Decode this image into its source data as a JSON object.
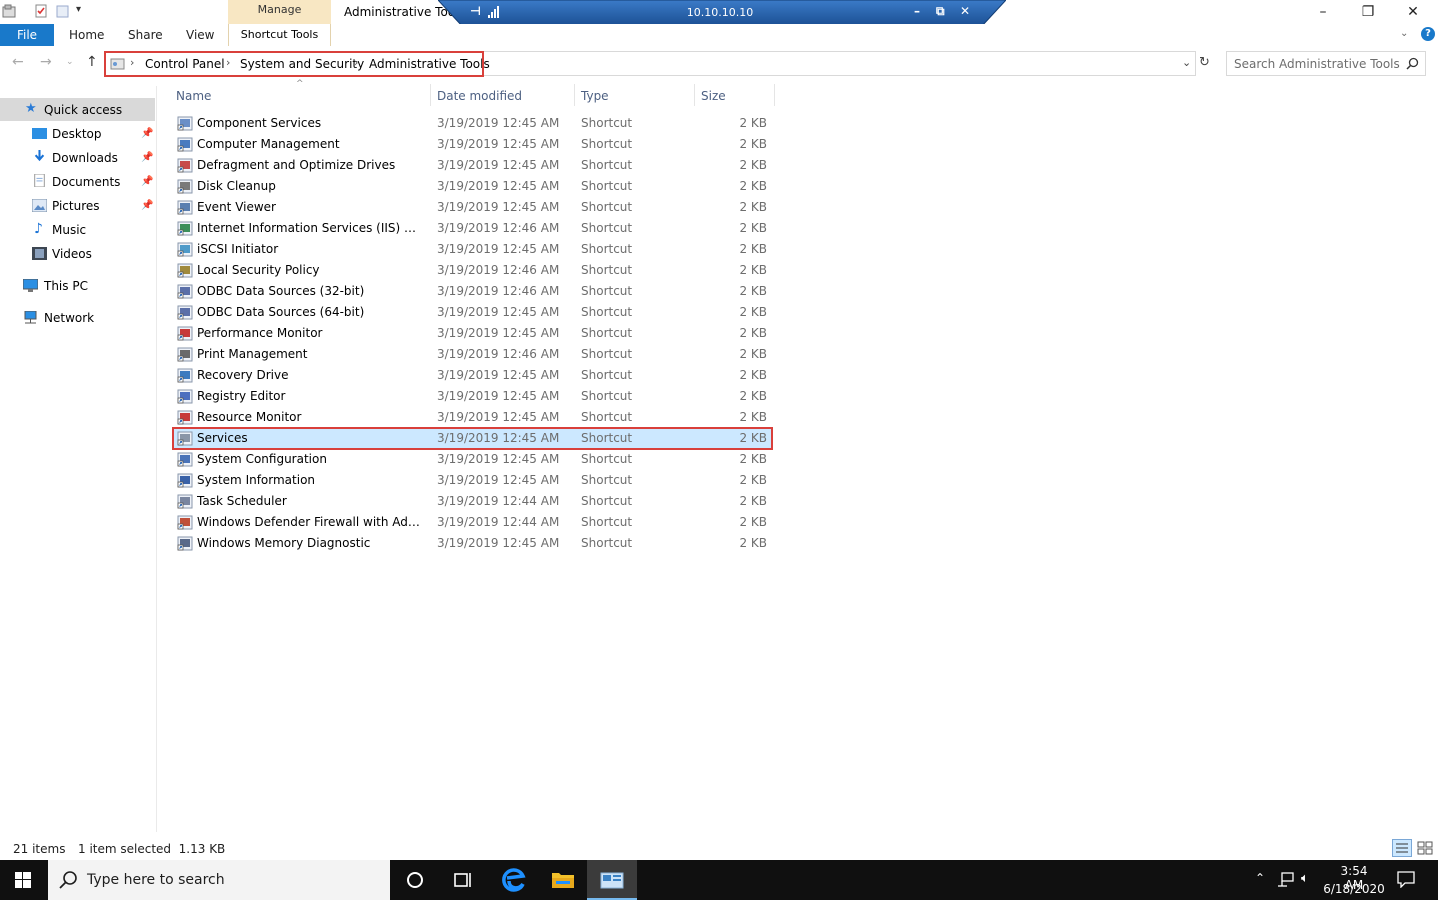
{
  "window": {
    "title": "Administrative Tools",
    "contextual_group": "Manage",
    "contextual_tab": "Shortcut Tools"
  },
  "rdp": {
    "host": "10.10.10.10"
  },
  "ribbon": {
    "tabs": [
      "File",
      "Home",
      "Share",
      "View"
    ]
  },
  "address": {
    "breadcrumbs": [
      "Control Panel",
      "System and Security",
      "Administrative Tools"
    ],
    "search_placeholder": "Search Administrative Tools"
  },
  "navpane": {
    "quick_access": "Quick access",
    "items": [
      "Desktop",
      "Downloads",
      "Documents",
      "Pictures",
      "Music",
      "Videos"
    ],
    "this_pc": "This PC",
    "network": "Network"
  },
  "columns": {
    "name": "Name",
    "date": "Date modified",
    "type": "Type",
    "size": "Size"
  },
  "files": [
    {
      "name": "Component Services",
      "date": "3/19/2019 12:45 AM",
      "type": "Shortcut",
      "size": "2 KB"
    },
    {
      "name": "Computer Management",
      "date": "3/19/2019 12:45 AM",
      "type": "Shortcut",
      "size": "2 KB"
    },
    {
      "name": "Defragment and Optimize Drives",
      "date": "3/19/2019 12:45 AM",
      "type": "Shortcut",
      "size": "2 KB"
    },
    {
      "name": "Disk Cleanup",
      "date": "3/19/2019 12:45 AM",
      "type": "Shortcut",
      "size": "2 KB"
    },
    {
      "name": "Event Viewer",
      "date": "3/19/2019 12:45 AM",
      "type": "Shortcut",
      "size": "2 KB"
    },
    {
      "name": "Internet Information Services (IIS) Manager",
      "date": "3/19/2019 12:46 AM",
      "type": "Shortcut",
      "size": "2 KB"
    },
    {
      "name": "iSCSI Initiator",
      "date": "3/19/2019 12:45 AM",
      "type": "Shortcut",
      "size": "2 KB"
    },
    {
      "name": "Local Security Policy",
      "date": "3/19/2019 12:46 AM",
      "type": "Shortcut",
      "size": "2 KB"
    },
    {
      "name": "ODBC Data Sources (32-bit)",
      "date": "3/19/2019 12:46 AM",
      "type": "Shortcut",
      "size": "2 KB"
    },
    {
      "name": "ODBC Data Sources (64-bit)",
      "date": "3/19/2019 12:45 AM",
      "type": "Shortcut",
      "size": "2 KB"
    },
    {
      "name": "Performance Monitor",
      "date": "3/19/2019 12:45 AM",
      "type": "Shortcut",
      "size": "2 KB"
    },
    {
      "name": "Print Management",
      "date": "3/19/2019 12:46 AM",
      "type": "Shortcut",
      "size": "2 KB"
    },
    {
      "name": "Recovery Drive",
      "date": "3/19/2019 12:45 AM",
      "type": "Shortcut",
      "size": "2 KB"
    },
    {
      "name": "Registry Editor",
      "date": "3/19/2019 12:45 AM",
      "type": "Shortcut",
      "size": "2 KB"
    },
    {
      "name": "Resource Monitor",
      "date": "3/19/2019 12:45 AM",
      "type": "Shortcut",
      "size": "2 KB"
    },
    {
      "name": "Services",
      "date": "3/19/2019 12:45 AM",
      "type": "Shortcut",
      "size": "2 KB",
      "selected": true
    },
    {
      "name": "System Configuration",
      "date": "3/19/2019 12:45 AM",
      "type": "Shortcut",
      "size": "2 KB"
    },
    {
      "name": "System Information",
      "date": "3/19/2019 12:45 AM",
      "type": "Shortcut",
      "size": "2 KB"
    },
    {
      "name": "Task Scheduler",
      "date": "3/19/2019 12:44 AM",
      "type": "Shortcut",
      "size": "2 KB"
    },
    {
      "name": "Windows Defender Firewall with Advanc...",
      "date": "3/19/2019 12:44 AM",
      "type": "Shortcut",
      "size": "2 KB"
    },
    {
      "name": "Windows Memory Diagnostic",
      "date": "3/19/2019 12:45 AM",
      "type": "Shortcut",
      "size": "2 KB"
    }
  ],
  "status": {
    "count": "21 items",
    "selection": "1 item selected  1.13 KB"
  },
  "taskbar": {
    "search_placeholder": "Type here to search",
    "time": "3:54 AM",
    "date": "6/18/2020"
  },
  "colors": {
    "accent": "#1979ca",
    "selection": "#cce8ff",
    "highlight_box": "#d9403b"
  }
}
